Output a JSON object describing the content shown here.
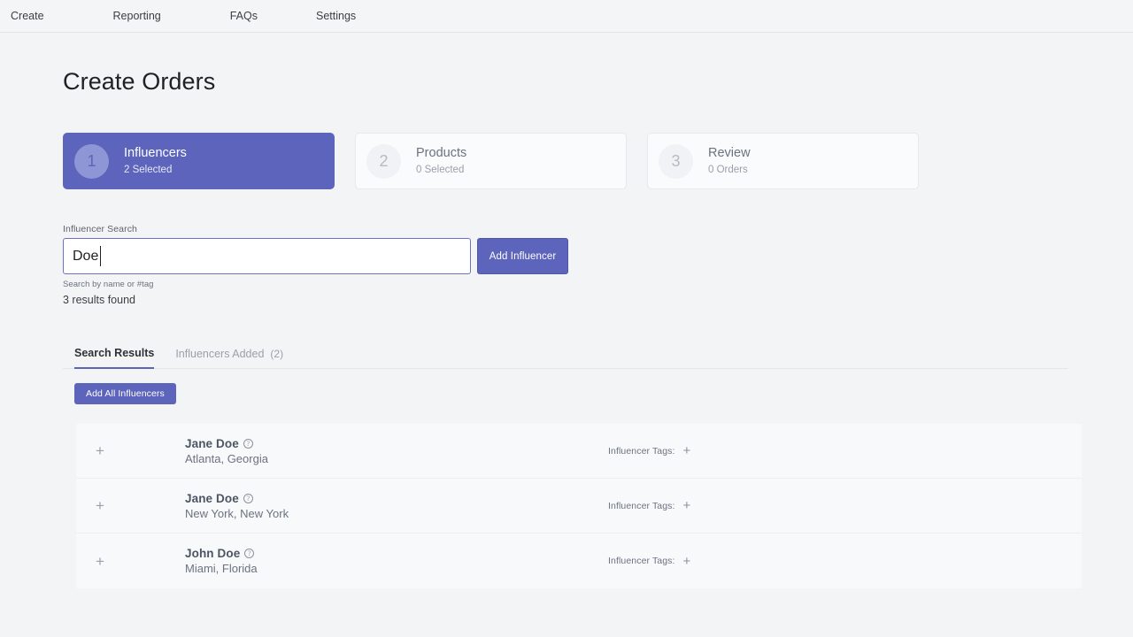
{
  "nav": {
    "items": [
      {
        "label": "Create"
      },
      {
        "label": "Reporting"
      },
      {
        "label": "FAQs"
      },
      {
        "label": "Settings"
      }
    ]
  },
  "page": {
    "title": "Create Orders"
  },
  "steps": [
    {
      "number": "1",
      "name": "Influencers",
      "sub": "2 Selected",
      "active": true
    },
    {
      "number": "2",
      "name": "Products",
      "sub": "0 Selected",
      "active": false
    },
    {
      "number": "3",
      "name": "Review",
      "sub": "0 Orders",
      "active": false
    }
  ],
  "search": {
    "label": "Influencer Search",
    "value": "Doe",
    "placeholder": "",
    "button_label": "Add Influencer",
    "hint": "Search by name or #tag",
    "results_found": "3 results found"
  },
  "tabs": {
    "search_results": "Search Results",
    "influencers_added": "Influencers Added",
    "influencers_added_count": "(2)"
  },
  "actions": {
    "add_all_label": "Add All Influencers"
  },
  "results": {
    "tags_label": "Influencer Tags:",
    "add_glyph": "+",
    "info_glyph": "?",
    "rows": [
      {
        "name": "Jane Doe",
        "location": "Atlanta, Georgia"
      },
      {
        "name": "Jane Doe",
        "location": "New York, New York"
      },
      {
        "name": "John Doe",
        "location": "Miami, Florida"
      }
    ]
  },
  "colors": {
    "accent": "#5c64bb",
    "accent_light": "#8e96d6",
    "page_background": "#f3f4f6",
    "row_background": "#f8f9fb",
    "muted_text": "#9aa0aa"
  }
}
